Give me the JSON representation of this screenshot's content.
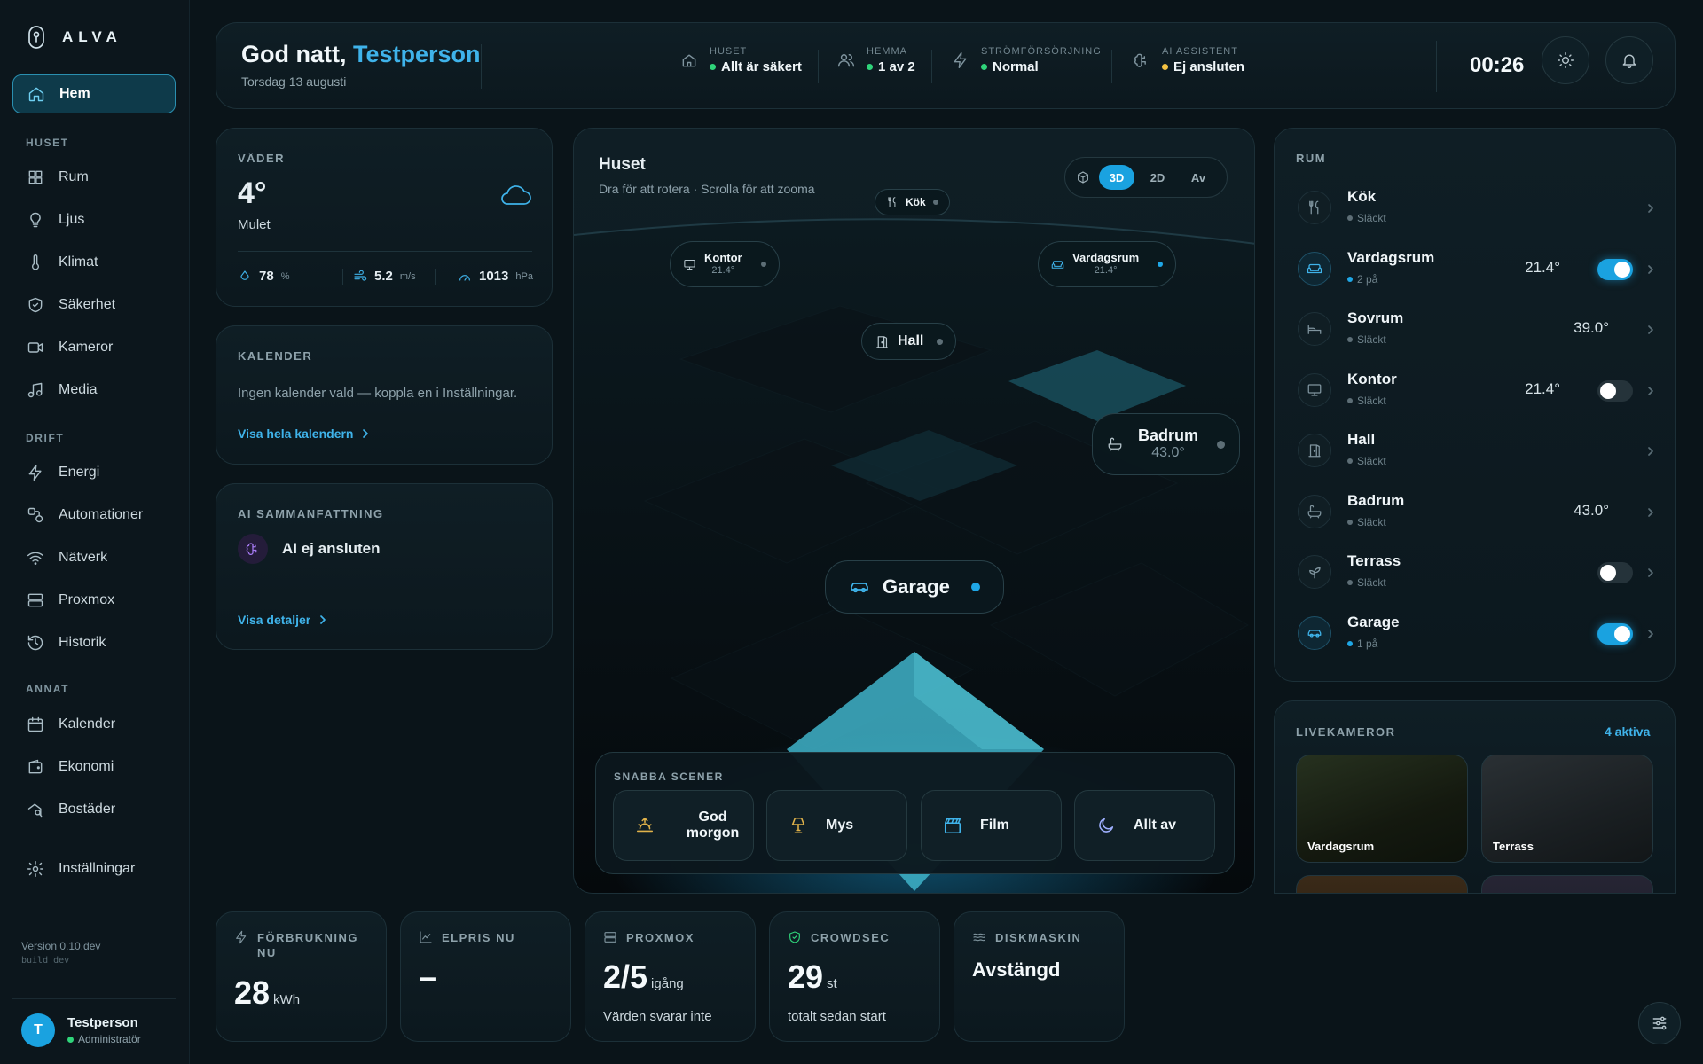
{
  "app": {
    "name": "ALVA"
  },
  "sidebar": {
    "home": "Hem",
    "sections": [
      {
        "title": "HUSET",
        "items": [
          {
            "label": "Rum",
            "icon": "grid-icon"
          },
          {
            "label": "Ljus",
            "icon": "bulb-icon"
          },
          {
            "label": "Klimat",
            "icon": "thermometer-icon"
          },
          {
            "label": "Säkerhet",
            "icon": "shield-icon"
          },
          {
            "label": "Kameror",
            "icon": "camera-icon"
          },
          {
            "label": "Media",
            "icon": "music-icon"
          }
        ]
      },
      {
        "title": "DRIFT",
        "items": [
          {
            "label": "Energi",
            "icon": "bolt-icon"
          },
          {
            "label": "Automationer",
            "icon": "automation-icon"
          },
          {
            "label": "Nätverk",
            "icon": "wifi-icon"
          },
          {
            "label": "Proxmox",
            "icon": "server-icon"
          },
          {
            "label": "Historik",
            "icon": "history-icon"
          }
        ]
      },
      {
        "title": "ANNAT",
        "items": [
          {
            "label": "Kalender",
            "icon": "calendar-icon"
          },
          {
            "label": "Ekonomi",
            "icon": "wallet-icon"
          },
          {
            "label": "Bostäder",
            "icon": "home-search-icon"
          }
        ]
      }
    ],
    "settings": "Inställningar",
    "version": "Version 0.10.dev",
    "build": "build dev",
    "user": {
      "initial": "T",
      "name": "Testperson",
      "role": "Administratör"
    }
  },
  "header": {
    "greeting": "God natt,",
    "name": "Testperson",
    "date": "Torsdag 13 augusti",
    "stats": [
      {
        "label": "HUSET",
        "value": "Allt är säkert",
        "status": "green"
      },
      {
        "label": "HEMMA",
        "value": "1 av 2",
        "status": "green"
      },
      {
        "label": "STRÖMFÖRSÖRJNING",
        "value": "Normal",
        "status": "green"
      },
      {
        "label": "AI ASSISTENT",
        "value": "Ej ansluten",
        "status": "yellow"
      }
    ],
    "time": "00:26"
  },
  "weather": {
    "title": "VÄDER",
    "temp": "4°",
    "condition": "Mulet",
    "humidity": "78",
    "humidity_unit": "%",
    "wind": "5.2",
    "wind_unit": "m/s",
    "pressure": "1013",
    "pressure_unit": "hPa"
  },
  "calendar": {
    "title": "KALENDER",
    "text": "Ingen kalender vald — koppla en i Inställningar.",
    "link": "Visa hela kalendern"
  },
  "ai": {
    "title": "AI SAMMANFATTNING",
    "status": "AI ej ansluten",
    "link": "Visa detaljer"
  },
  "house": {
    "title": "Huset",
    "subtitle": "Dra för att rotera · Scrolla för att zooma",
    "view_modes": [
      "3D",
      "2D",
      "Av"
    ],
    "selected_mode": "3D",
    "labels": {
      "kok": {
        "name": "Kök"
      },
      "kontor": {
        "name": "Kontor",
        "temp": "21.4°"
      },
      "vardagsrum": {
        "name": "Vardagsrum",
        "temp": "21.4°"
      },
      "hall": {
        "name": "Hall"
      },
      "badrum": {
        "name": "Badrum",
        "temp": "43.0°"
      },
      "garage": {
        "name": "Garage"
      }
    }
  },
  "scenes": {
    "title": "SNABBA SCENER",
    "items": [
      {
        "label": "God morgon",
        "color": "#e0b24a"
      },
      {
        "label": "Mys",
        "color": "#e0b24a"
      },
      {
        "label": "Film",
        "color": "#3fb3ea"
      },
      {
        "label": "Allt av",
        "color": "#9fb0ff"
      }
    ]
  },
  "rooms": {
    "title": "RUM",
    "items": [
      {
        "name": "Kök",
        "status": "Släckt",
        "temp": "",
        "toggle": null
      },
      {
        "name": "Vardagsrum",
        "status": "2 på",
        "temp": "21.4°",
        "toggle": true
      },
      {
        "name": "Sovrum",
        "status": "Släckt",
        "temp": "39.0°",
        "toggle": null
      },
      {
        "name": "Kontor",
        "status": "Släckt",
        "temp": "21.4°",
        "toggle": false
      },
      {
        "name": "Hall",
        "status": "Släckt",
        "temp": "",
        "toggle": null
      },
      {
        "name": "Badrum",
        "status": "Släckt",
        "temp": "43.0°",
        "toggle": null
      },
      {
        "name": "Terrass",
        "status": "Släckt",
        "temp": "",
        "toggle": false
      },
      {
        "name": "Garage",
        "status": "1 på",
        "temp": "",
        "toggle": true
      }
    ]
  },
  "cameras": {
    "title": "LIVEKAMEROR",
    "active": "4 aktiva",
    "items": [
      {
        "name": "Vardagsrum"
      },
      {
        "name": "Terrass"
      }
    ]
  },
  "kpis": [
    {
      "label": "FÖRBRUKNING NU",
      "value": "28",
      "unit": "kWh",
      "desc": ""
    },
    {
      "label": "ELPRIS NU",
      "value": "–",
      "unit": "",
      "desc": ""
    },
    {
      "label": "PROXMOX",
      "value": "2/5",
      "unit": "igång",
      "desc": "Värden svarar inte"
    },
    {
      "label": "CROWDSEC",
      "value": "29",
      "unit": "st",
      "desc": "totalt sedan start"
    },
    {
      "label": "DISKMASKIN",
      "value": "Avstängd",
      "unit": "",
      "desc": ""
    }
  ],
  "colors": {
    "accent": "#1aa2e0",
    "ok": "#2fd47a",
    "warn": "#f5c242",
    "background": "#0a1419"
  }
}
